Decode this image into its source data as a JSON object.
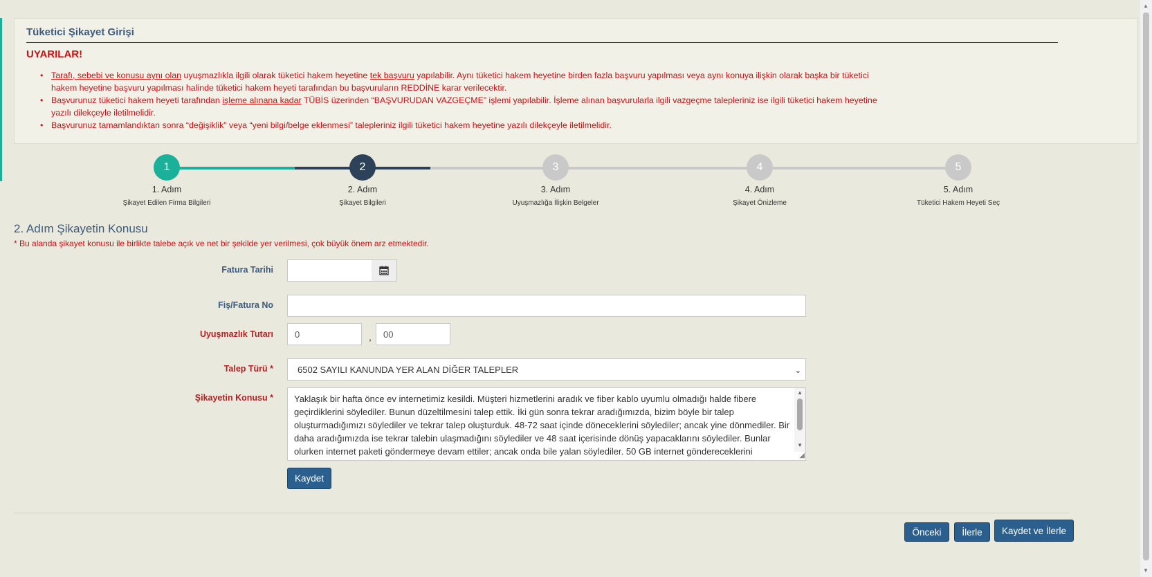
{
  "panel": {
    "title": "Tüketici Şikayet Girişi",
    "warning_heading": "UYARILAR!",
    "warnings": [
      {
        "lead_underlined": "Tarafı, sebebi ve konusu aynı olan",
        "part2": " uyuşmazlıkla ilgili olarak tüketici hakem heyetine ",
        "underlined2": "tek başvuru",
        "part3": " yapılabilir. Aynı tüketici hakem heyetine birden fazla başvuru yapılması veya aynı konuya ilişkin olarak başka bir tüketici hakem heyetine başvuru yapılması halinde tüketici hakem heyeti tarafından bu başvuruların REDDİNE karar verilecektir."
      },
      {
        "part1": "Başvurunuz tüketici hakem heyeti tarafından ",
        "underlined": "işleme alınana kadar",
        "part2": " TÜBİS üzerinden “BAŞVURUDAN VAZGEÇME” işlemi yapılabilir. İşleme alınan başvurularla ilgili vazgeçme talepleriniz ise ilgili tüketici hakem heyetine yazılı dilekçeyle iletilmelidir."
      },
      {
        "text": "Başvurunuz tamamlandıktan sonra “değişiklik” veya “yeni bilgi/belge eklenmesi” talepleriniz ilgili tüketici hakem heyetine yazılı dilekçeyle iletilmelidir."
      }
    ]
  },
  "stepper": {
    "steps": [
      {
        "number": "1",
        "title": "1. Adım",
        "subtitle": "Şikayet Edilen Firma Bilgileri",
        "state": "done"
      },
      {
        "number": "2",
        "title": "2. Adım",
        "subtitle": "Şikayet Bilgileri",
        "state": "active"
      },
      {
        "number": "3",
        "title": "3. Adım",
        "subtitle": "Uyuşmazlığa İlişkin Belgeler",
        "state": "todo"
      },
      {
        "number": "4",
        "title": "4. Adım",
        "subtitle": "Şikayet Önizleme",
        "state": "todo"
      },
      {
        "number": "5",
        "title": "5. Adım",
        "subtitle": "Tüketici Hakem Heyeti Seç",
        "state": "todo"
      }
    ],
    "colors": {
      "done": "#1bb09a",
      "active": "#2d4158",
      "todo": "#c9c9c9"
    }
  },
  "section": {
    "title": "2. Adım Şikayetin Konusu",
    "note": "* Bu alanda şikayet konusu ile birlikte talebe açık ve net bir şekilde yer verilmesi, çok büyük önem arz etmektedir."
  },
  "form": {
    "invoice_date": {
      "label": "Fatura Tarihi",
      "value": "",
      "icon": "calendar-icon"
    },
    "receipt_no": {
      "label": "Fiş/Fatura No",
      "value": ""
    },
    "dispute_amount": {
      "label": "Uyuşmazlık Tutarı",
      "whole": "0",
      "separator": ",",
      "fraction": "00"
    },
    "request_type": {
      "label": "Talep Türü *",
      "selected": "6502 SAYILI KANUNDA YER ALAN DİĞER TALEPLER"
    },
    "complaint_subject": {
      "label": "Şikayetin Konusu *",
      "value": "Yaklaşık bir hafta önce ev internetimiz kesildi. Müşteri hizmetlerini aradık ve fiber kablo uyumlu olmadığı halde fibere geçirdiklerini söylediler. Bunun düzeltilmesini talep ettik. İki gün sonra tekrar aradığımızda, bizim böyle bir talep oluşturmadığımızı söylediler ve tekrar talep oluşturduk. 48-72 saat içinde döneceklerini söylediler; ancak yine dönmediler. Bir daha aradığımızda ise tekrar talebin ulaşmadığını söylediler ve 48 saat içerisinde dönüş yapacaklarını söylediler. Bunlar olurken internet paketi göndermeye devam ettiler; ancak onda bile yalan söylediler. 50 GB internet göndereceklerini"
    },
    "save_button": "Kaydet"
  },
  "footer": {
    "prev_button": "Önceki",
    "next_button": "İlerle",
    "save_next_button": "Kaydet ve İlerle"
  }
}
